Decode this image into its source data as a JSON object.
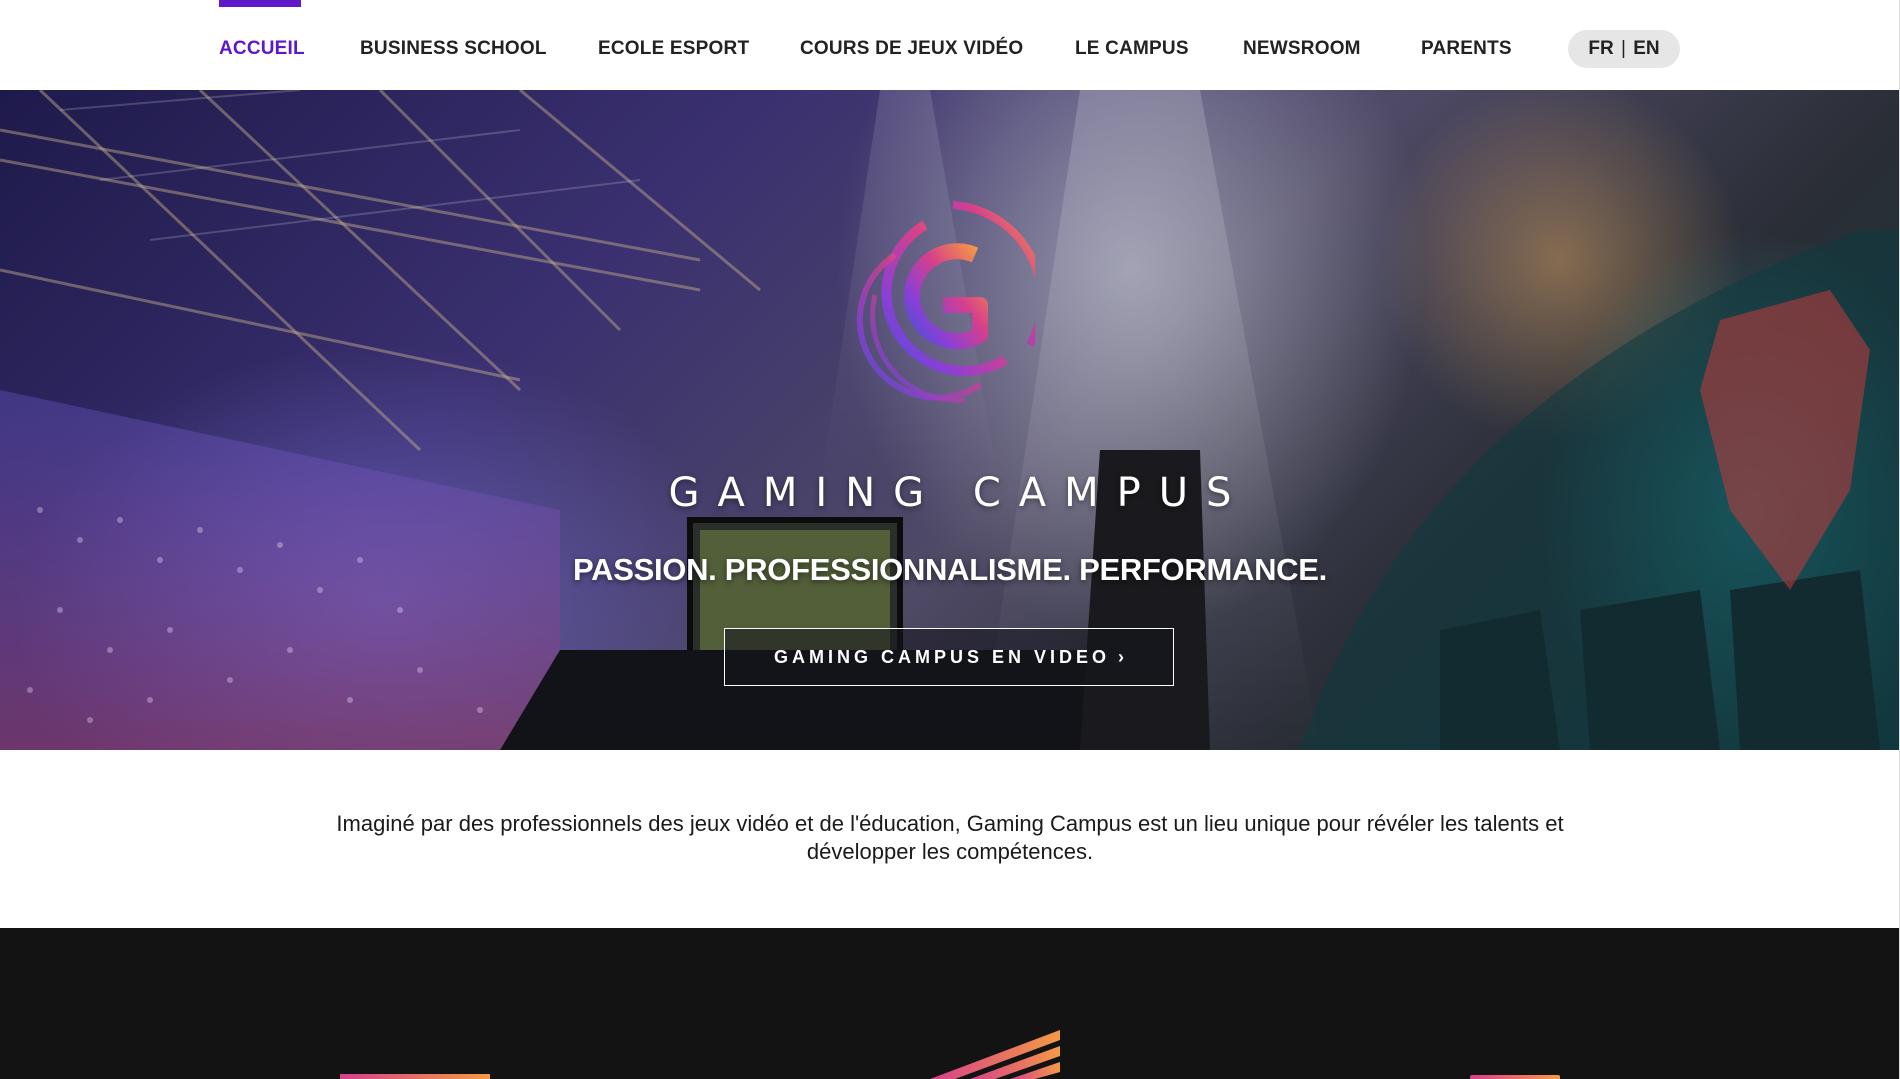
{
  "nav": {
    "items": [
      {
        "label": "ACCUEIL",
        "active": true
      },
      {
        "label": "BUSINESS SCHOOL",
        "active": false
      },
      {
        "label": "ECOLE ESPORT",
        "active": false
      },
      {
        "label": "COURS DE JEUX VIDÉO",
        "active": false
      },
      {
        "label": "LE CAMPUS",
        "active": false
      },
      {
        "label": "NEWSROOM",
        "active": false
      },
      {
        "label": "PARENTS",
        "active": false
      }
    ],
    "lang": {
      "fr": "FR",
      "separator": "|",
      "en": "EN"
    },
    "active_color": "#5e17c9"
  },
  "hero": {
    "logo_icon": "gaming-campus-g-logo",
    "brand_name": "GAMING CAMPUS",
    "tagline": "PASSION. PROFESSIONNALISME. PERFORMANCE.",
    "video_button": "GAMING CAMPUS EN VIDEO",
    "video_button_icon": "chevron-right-icon",
    "logo_gradient": [
      "#f59a45",
      "#d6408a",
      "#8a3fd6",
      "#4a52d9"
    ]
  },
  "intro": {
    "text": "Imaginé par des professionnels des jeux vidéo et de l'éducation, Gaming Campus est un lieu unique pour révéler les talents et développer les compétences."
  },
  "dark_section": {
    "background": "#141314",
    "accent_gradient": [
      "#f59a45",
      "#d6408a",
      "#8a3fd6"
    ]
  }
}
